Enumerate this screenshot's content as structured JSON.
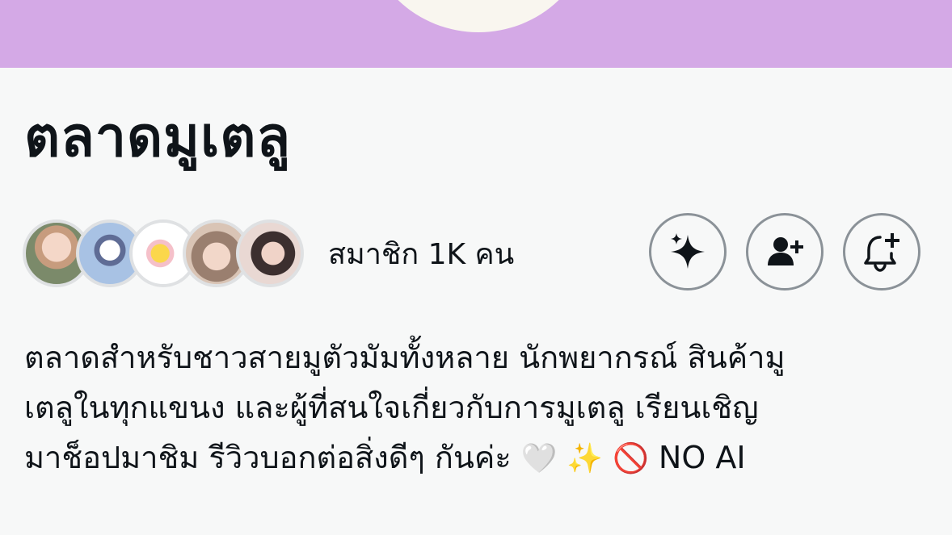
{
  "community": {
    "name": "ตลาดมูเตลู",
    "members_text": "สมาชิก 1K คน",
    "bio_lines": [
      "ตลาดสำหรับชาวสายมูตัวมัมทั้งหลาย นักพยากรณ์ สินค้ามู",
      "เตลูในทุกแขนง และผู้ที่สนใจเกี่ยวกับการมูเตลู เรียนเชิญ",
      "มาช็อปมาชิม รีวิวบอกต่อสิ่งดีๆ กันค่ะ"
    ],
    "bio_emojis": "🤍 ✨",
    "bio_no_ai_emoji": "🚫",
    "bio_no_ai_text": "NO AI"
  },
  "actions": {
    "explore_icon": "sparkle-icon",
    "join_icon": "person-add-icon",
    "notify_icon": "bell-plus-icon"
  },
  "colors": {
    "banner": "#d4a9e6",
    "background": "#f7f8f8",
    "text": "#0f1419",
    "button_border": "#8b9298"
  }
}
